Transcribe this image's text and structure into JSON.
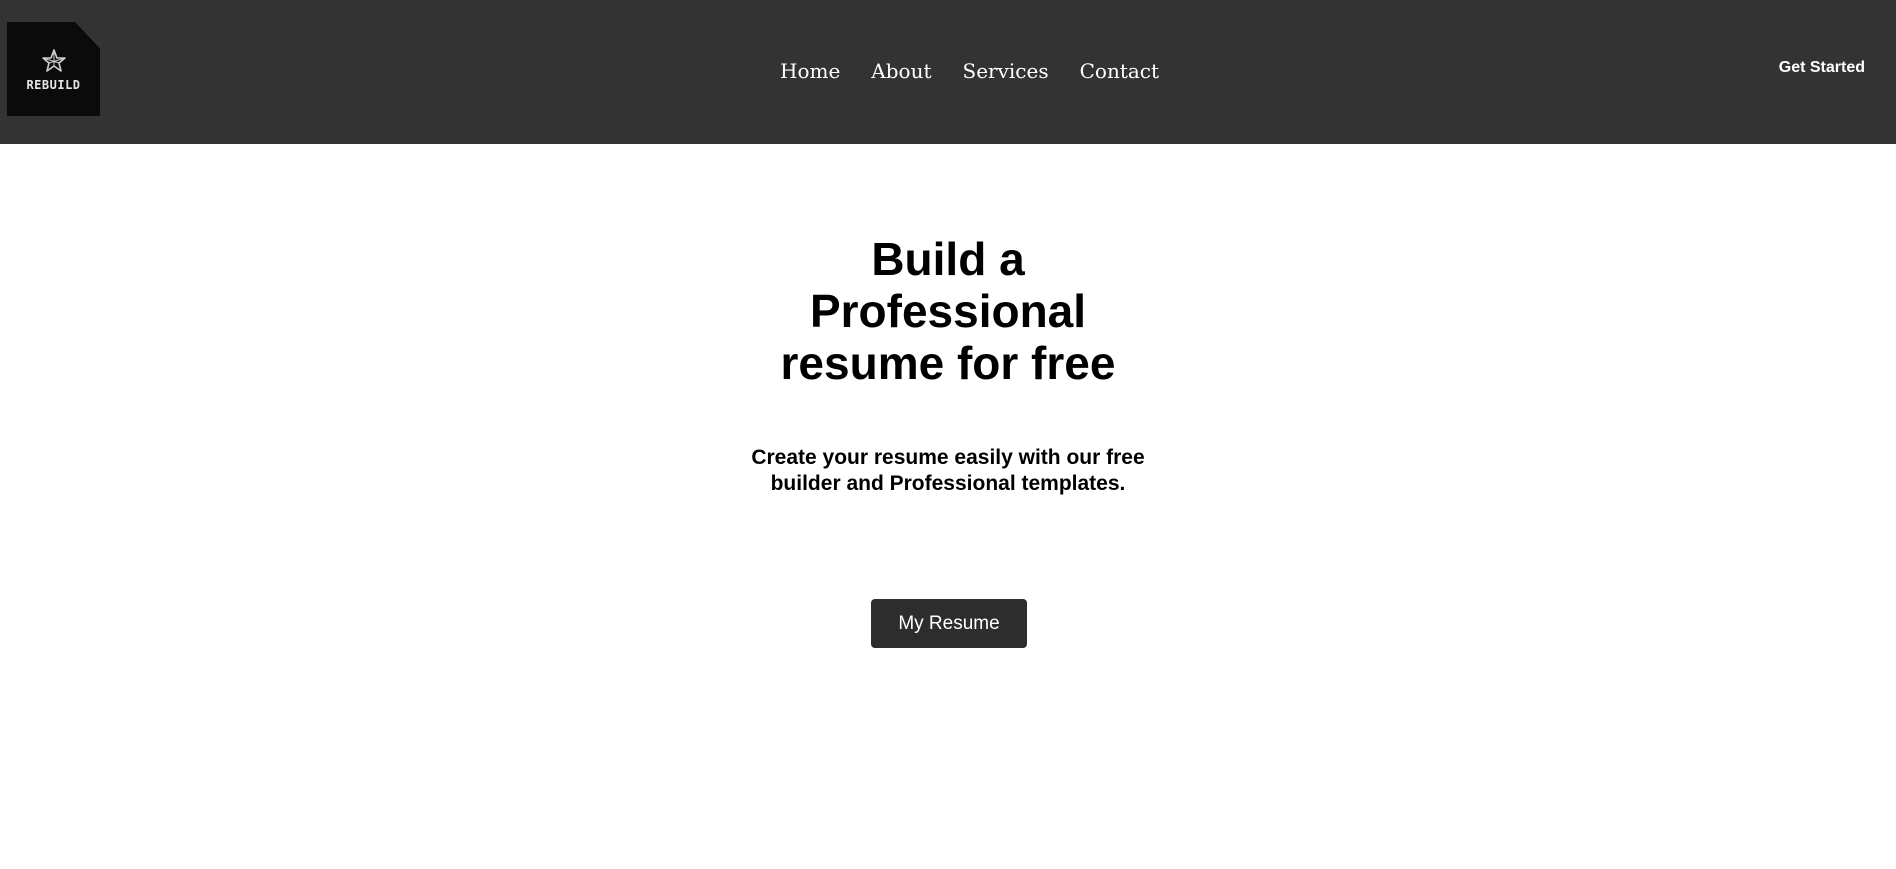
{
  "header": {
    "logo": {
      "text": "REBUILD",
      "icon": "star-mark-icon",
      "background": "#0b0b0b"
    },
    "nav": [
      {
        "label": "Home"
      },
      {
        "label": "About"
      },
      {
        "label": "Services"
      },
      {
        "label": "Contact"
      }
    ],
    "cta_label": "Get Started",
    "background": "#333333"
  },
  "hero": {
    "title": "Build a Professional resume for free",
    "subtitle": "Create your resume easily with our free builder and Professional templates.",
    "button_label": "My Resume"
  },
  "colors": {
    "accent": "#2d2d2d",
    "page_background": "#ffffff",
    "text": "#000000"
  }
}
